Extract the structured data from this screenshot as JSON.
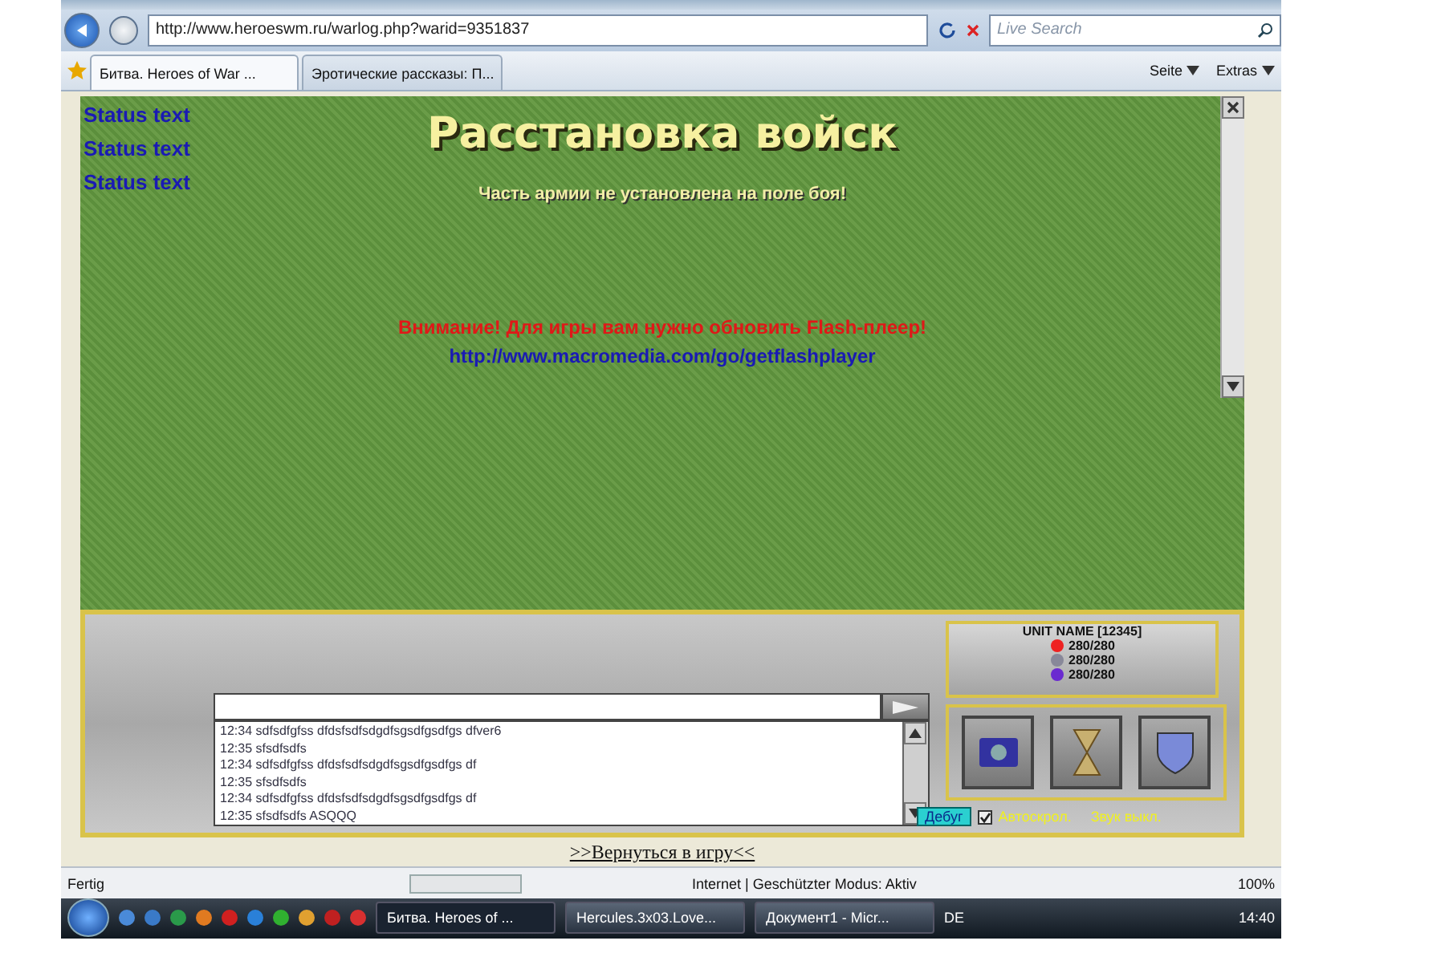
{
  "address_bar": {
    "url": "http://www.heroeswm.ru/warlog.php?warid=9351837",
    "search_placeholder": "Live Search"
  },
  "tabs": [
    {
      "label": "Битва. Heroes of War ...",
      "selected": true
    },
    {
      "label": "Эротические рассказы: П...",
      "selected": false
    }
  ],
  "command_bar": [
    "Seite",
    "Extras"
  ],
  "game": {
    "status_texts": [
      "Status text",
      "Status text",
      "Status text"
    ],
    "title": "Расстановка войск",
    "subtitle": "Часть армии не установлена на поле боя!",
    "warning": "Внимание! Для игры вам нужно обновить Flash-плеер!",
    "link": "http://www.macromedia.com/go/getflashplayer"
  },
  "chat": {
    "messages": [
      {
        "time": "12:34",
        "text": "sdfsdfgfss dfdsfsdfsdgdfsgsdfgsdfgs dfver6"
      },
      {
        "time": "12:35",
        "text": "sfsdfsdfs"
      },
      {
        "time": "12:34",
        "text": "sdfsdfgfss dfdsfsdfsdgdfsgsdfgsdfgs df"
      },
      {
        "time": "12:35",
        "text": "sfsdfsdfs"
      },
      {
        "time": "12:34",
        "text": "sdfsdfgfss dfdsfsdfsdgdfsgsdfgsdfgs df"
      },
      {
        "time": "12:35",
        "text": "sfsdfsdfs ASQQQ"
      }
    ]
  },
  "unit": {
    "name": "UNIT NAME [12345]",
    "stats": [
      {
        "kind": "health",
        "value": "280/280"
      },
      {
        "kind": "attack",
        "value": "280/280"
      },
      {
        "kind": "mana",
        "value": "280/280"
      }
    ]
  },
  "options": {
    "debug": "Дебуг",
    "autoscroll": {
      "label": "Автоскрол.",
      "checked": true
    },
    "sound": "Звук выкл."
  },
  "return_link": ">>Вернуться в игру<<",
  "status_bar": {
    "text": "Fertig",
    "zone": "Internet | Geschützter Modus: Aktiv",
    "zoom": "100%"
  },
  "taskbar": {
    "windows": [
      {
        "label": "Битва. Heroes of ...",
        "selected": true
      },
      {
        "label": "Hercules.3x03.Love...",
        "selected": false
      },
      {
        "label": "Документ1 - Micr...",
        "selected": false
      }
    ],
    "lang": "DE",
    "time": "14:40"
  }
}
